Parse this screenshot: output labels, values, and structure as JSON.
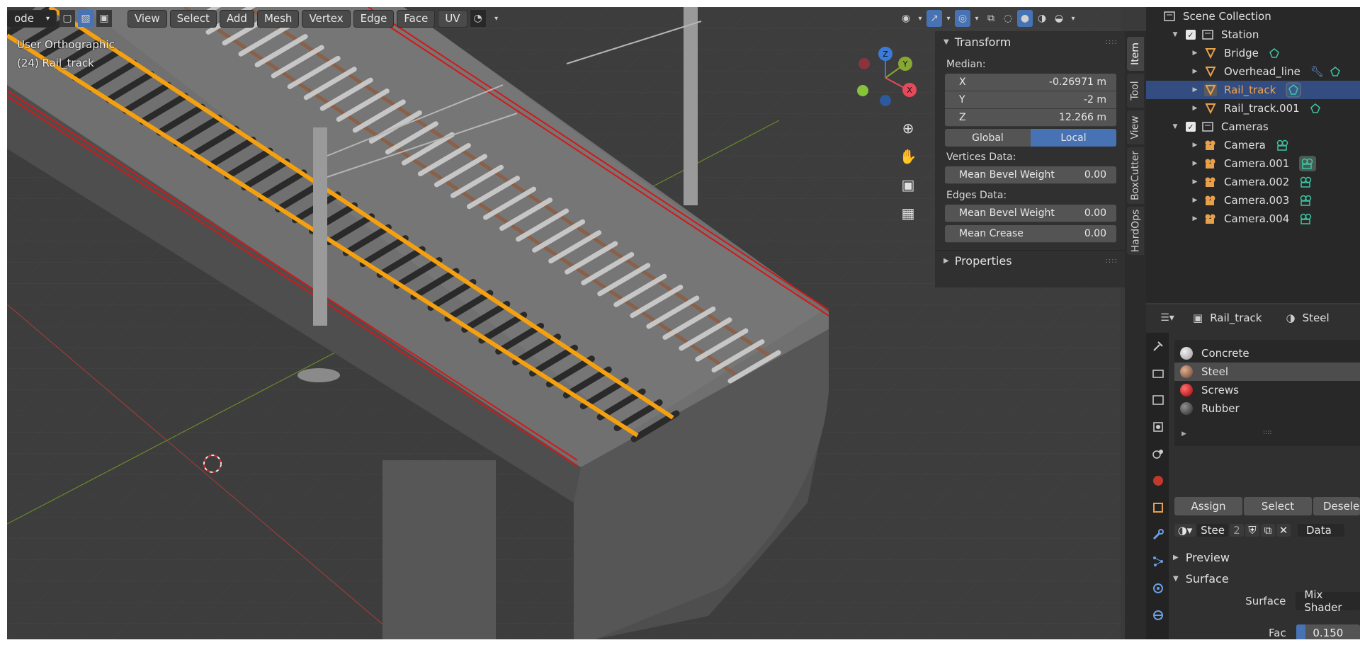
{
  "viewport": {
    "mode_partial": "ode",
    "menus": [
      "View",
      "Select",
      "Add",
      "Mesh",
      "Vertex",
      "Edge",
      "Face",
      "UV"
    ],
    "view_label": "User Orthographic",
    "object_label": "(24) Rail_track",
    "gizmo_axes": {
      "x": "X",
      "y": "Y",
      "z": "Z"
    }
  },
  "npanel": {
    "transform_title": "Transform",
    "median_label": "Median:",
    "fields": [
      {
        "axis": "X",
        "value": "-0.26971 m"
      },
      {
        "axis": "Y",
        "value": "-2 m"
      },
      {
        "axis": "Z",
        "value": "12.266 m"
      }
    ],
    "global_label": "Global",
    "local_label": "Local",
    "vertices_label": "Vertices Data:",
    "vertex_bevel": {
      "label": "Mean Bevel Weight",
      "value": "0.00"
    },
    "edges_label": "Edges Data:",
    "edge_bevel": {
      "label": "Mean Bevel Weight",
      "value": "0.00"
    },
    "edge_crease": {
      "label": "Mean Crease",
      "value": "0.00"
    },
    "properties_title": "Properties"
  },
  "side_tabs": [
    "Item",
    "Tool",
    "View",
    "BoxCutter",
    "HardOps"
  ],
  "outliner": {
    "root": "Scene Collection",
    "rows": [
      {
        "name": "Station",
        "kind": "collection",
        "depth": 1
      },
      {
        "name": "Bridge",
        "kind": "mesh",
        "depth": 2
      },
      {
        "name": "Overhead_line",
        "kind": "mesh",
        "depth": 2
      },
      {
        "name": "Rail_track",
        "kind": "mesh",
        "depth": 2,
        "selected": true
      },
      {
        "name": "Rail_track.001",
        "kind": "mesh",
        "depth": 2
      },
      {
        "name": "Cameras",
        "kind": "collection",
        "depth": 1
      },
      {
        "name": "Camera",
        "kind": "camera",
        "depth": 2
      },
      {
        "name": "Camera.001",
        "kind": "camera",
        "depth": 2
      },
      {
        "name": "Camera.002",
        "kind": "camera",
        "depth": 2
      },
      {
        "name": "Camera.003",
        "kind": "camera",
        "depth": 2
      },
      {
        "name": "Camera.004",
        "kind": "camera",
        "depth": 2
      }
    ]
  },
  "properties": {
    "object_name": "Rail_track",
    "material_name": "Steel",
    "materials": [
      {
        "name": "Concrete",
        "color": "#d4d4d4"
      },
      {
        "name": "Steel",
        "color": "#b07a5a",
        "selected": true
      },
      {
        "name": "Screws",
        "color": "#d21a1a"
      },
      {
        "name": "Rubber",
        "color": "#555555"
      }
    ],
    "assign_label": "Assign",
    "select_label": "Select",
    "deselect_partial": "Desele",
    "slot_name": "Stee",
    "users": "2",
    "link_label": "Data",
    "preview_label": "Preview",
    "surface_section": "Surface",
    "surface_label": "Surface",
    "surface_value": "Mix Shader",
    "fac_label": "Fac",
    "fac_value": "0.150",
    "fac_fraction": 0.15
  },
  "colors": {
    "selected_orange": "#f5a00f",
    "railing_red": "#d21919",
    "accent_blue": "#4772b3",
    "rail_brown": "#8a6048",
    "mesh_icon": "#e8a04a",
    "camera_icon": "#3ec6a3"
  }
}
